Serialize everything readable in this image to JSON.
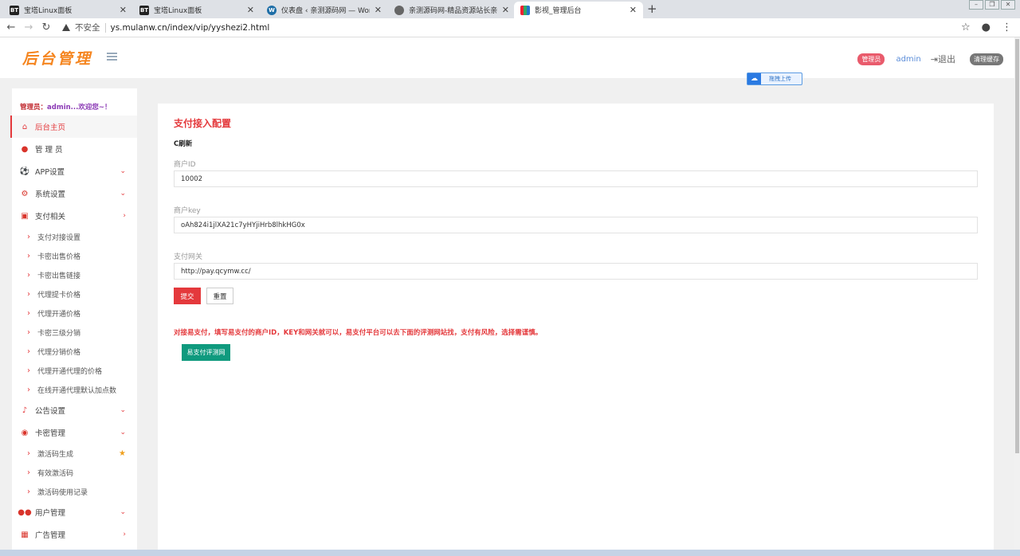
{
  "browser": {
    "tabs": [
      {
        "title": "宝塔Linux面板",
        "favicon": "BT",
        "active": false
      },
      {
        "title": "宝塔Linux面板",
        "favicon": "BT",
        "active": false
      },
      {
        "title": "仪表盘 ‹ 亲测源码网 — WordPr",
        "favicon": "wordpress-icon",
        "active": false
      },
      {
        "title": "亲测源码网-精品资源站长亲测",
        "favicon": "globe-icon",
        "active": false
      },
      {
        "title": "影视_管理后台",
        "favicon": "grid-icon",
        "active": true
      }
    ],
    "new_tab": "+",
    "insecure_label": "不安全",
    "url": "ys.mulanw.cn/index/vip/yyshezi2.html"
  },
  "header": {
    "logo": "后台管理",
    "role_badge": "管理员",
    "username": "admin",
    "logout": "退出",
    "clear_cache": "清理缓存",
    "upload_label": "拖拽上传"
  },
  "sidebar": {
    "welcome_prefix": "管理员：",
    "welcome_name": "admin...欢迎您~！",
    "items": [
      {
        "label": "后台主页",
        "icon": "home-icon",
        "active": true,
        "arrow": ""
      },
      {
        "label": "管 理 员",
        "icon": "user-icon",
        "arrow": ""
      },
      {
        "label": "APP设置",
        "icon": "soccer-icon",
        "arrow": "⌄"
      },
      {
        "label": "系统设置",
        "icon": "cogs-icon",
        "arrow": "⌄"
      },
      {
        "label": "支付相关",
        "icon": "money-icon",
        "arrow": "›"
      },
      {
        "label": "支付对接设置",
        "sub": true
      },
      {
        "label": "卡密出售价格",
        "sub": true
      },
      {
        "label": "卡密出售链接",
        "sub": true
      },
      {
        "label": "代理提卡价格",
        "sub": true
      },
      {
        "label": "代理开通价格",
        "sub": true
      },
      {
        "label": "卡密三级分销",
        "sub": true
      },
      {
        "label": "代理分销价格",
        "sub": true
      },
      {
        "label": "代理开通代理的价格",
        "sub": true
      },
      {
        "label": "在线开通代理默认加点数",
        "sub": true
      },
      {
        "label": "公告设置",
        "icon": "bell-icon",
        "arrow": "⌄"
      },
      {
        "label": "卡密管理",
        "icon": "globe-icon",
        "arrow": "⌄"
      },
      {
        "label": "激活码生成",
        "sub": true,
        "star": true
      },
      {
        "label": "有效激活码",
        "sub": true
      },
      {
        "label": "激活码使用记录",
        "sub": true
      },
      {
        "label": "用户管理",
        "icon": "users-icon",
        "arrow": "⌄"
      },
      {
        "label": "广告管理",
        "icon": "table-icon",
        "arrow": "›"
      }
    ]
  },
  "main": {
    "title": "支付接入配置",
    "refresh": "刷新",
    "fields": [
      {
        "label": "商户ID",
        "value": "10002"
      },
      {
        "label": "商户key",
        "value": "oAh824i1jlXA21c7yHYjiHrb8lhkHG0x"
      },
      {
        "label": "支付网关",
        "value": "http://pay.qcymw.cc/"
      }
    ],
    "submit": "提交",
    "reset": "重置",
    "notice": "对接易支付，填写易支付的商户ID，KEY和网关就可以，易支付平台可以去下面的评测网站找，支付有风险，选择需谨慎。",
    "eval_button": "易支付评测网"
  },
  "colors": {
    "accent": "#e4393c",
    "logo": "#f5851f",
    "teal": "#0f9a7e"
  }
}
